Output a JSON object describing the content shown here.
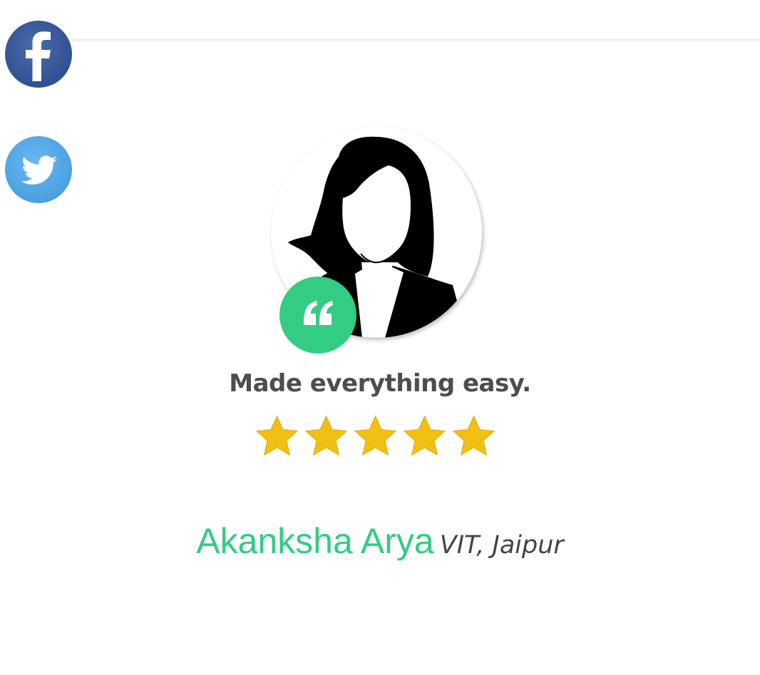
{
  "social": {
    "facebook": {
      "icon": "facebook-icon",
      "color": "#3b5998"
    },
    "twitter": {
      "icon": "twitter-icon",
      "color": "#55acee"
    }
  },
  "testimonial": {
    "avatar_icon": "person-silhouette-icon",
    "quote_icon": "quote-icon",
    "accent_color": "#33cc84",
    "headline": "Made everything easy.",
    "rating": {
      "value": 5,
      "max": 5,
      "star_color": "#f2c014"
    },
    "reviewer": {
      "name": "Akanksha Arya",
      "organization": "VIT, Jaipur"
    }
  }
}
